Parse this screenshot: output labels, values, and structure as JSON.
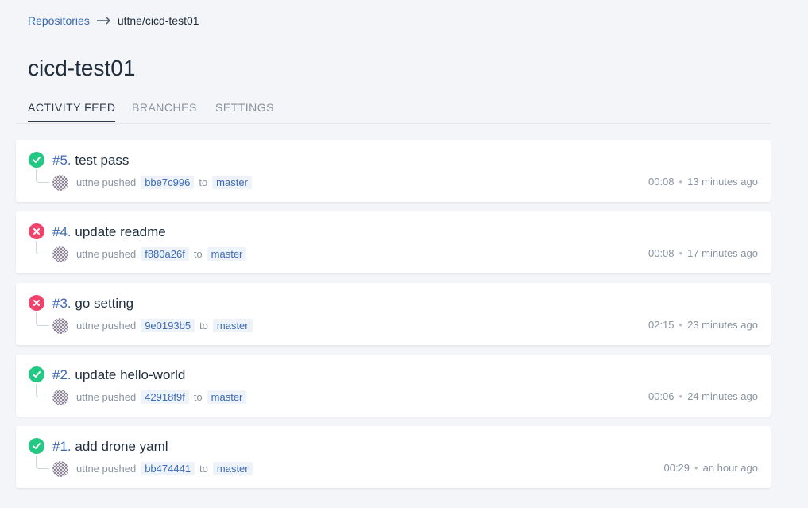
{
  "breadcrumb": {
    "link_label": "Repositories",
    "current": "uttne/cicd-test01"
  },
  "repo": {
    "title": "cicd-test01"
  },
  "tabs": [
    {
      "label": "ACTIVITY FEED",
      "active": true
    },
    {
      "label": "BRANCHES",
      "active": false
    },
    {
      "label": "SETTINGS",
      "active": false
    }
  ],
  "builds": [
    {
      "number": "#5.",
      "message": "test pass",
      "status": "success",
      "author": "uttne",
      "action": "pushed",
      "commit": "bbe7c996",
      "to": "to",
      "branch": "master",
      "duration": "00:08",
      "ago": "13 minutes ago"
    },
    {
      "number": "#4.",
      "message": "update readme",
      "status": "failure",
      "author": "uttne",
      "action": "pushed",
      "commit": "f880a26f",
      "to": "to",
      "branch": "master",
      "duration": "00:08",
      "ago": "17 minutes ago"
    },
    {
      "number": "#3.",
      "message": "go setting",
      "status": "failure",
      "author": "uttne",
      "action": "pushed",
      "commit": "9e0193b5",
      "to": "to",
      "branch": "master",
      "duration": "02:15",
      "ago": "23 minutes ago"
    },
    {
      "number": "#2.",
      "message": "update hello-world",
      "status": "success",
      "author": "uttne",
      "action": "pushed",
      "commit": "42918f9f",
      "to": "to",
      "branch": "master",
      "duration": "00:06",
      "ago": "24 minutes ago"
    },
    {
      "number": "#1.",
      "message": "add drone yaml",
      "status": "success",
      "author": "uttne",
      "action": "pushed",
      "commit": "bb474441",
      "to": "to",
      "branch": "master",
      "duration": "00:29",
      "ago": "an hour ago"
    }
  ],
  "colors": {
    "success": "#23c883",
    "failure": "#f0426b",
    "link": "#3c6bb5"
  },
  "icons": {
    "success": "check-icon",
    "failure": "x-icon",
    "breadcrumb_separator": "arrow-right-icon"
  }
}
